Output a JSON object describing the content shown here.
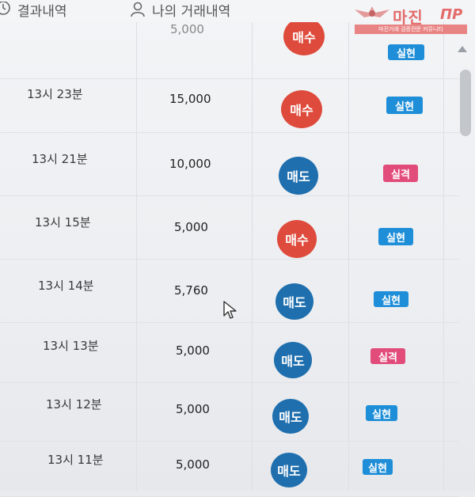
{
  "tabs": [
    {
      "label": "결과내역",
      "icon": "clock-icon"
    },
    {
      "label": "나의 거래내역",
      "icon": "user-icon"
    }
  ],
  "logo": {
    "title": "마진",
    "subtitle": "마진거래 검증전문 커뮤니티"
  },
  "partial_row": {
    "amount": "5,000",
    "action": "매수",
    "result": "실현"
  },
  "trades": [
    {
      "time": "13시 23분",
      "amount": "15,000",
      "action": "매수",
      "result": "실현"
    },
    {
      "time": "13시 21분",
      "amount": "10,000",
      "action": "매도",
      "result": "실격"
    },
    {
      "time": "13시 15분",
      "amount": "5,000",
      "action": "매수",
      "result": "실현"
    },
    {
      "time": "13시 14분",
      "amount": "5,760",
      "action": "매도",
      "result": "실현"
    },
    {
      "time": "13시 13분",
      "amount": "5,000",
      "action": "매도",
      "result": "실격"
    },
    {
      "time": "13시 12분",
      "amount": "5,000",
      "action": "매도",
      "result": "실현"
    },
    {
      "time": "13시 11분",
      "amount": "5,000",
      "action": "매도",
      "result": "실현"
    }
  ],
  "colors": {
    "buy": "#de4a3b",
    "sell": "#1f6fae",
    "realized": "#1e8ed8",
    "failed": "#e24c7a"
  }
}
